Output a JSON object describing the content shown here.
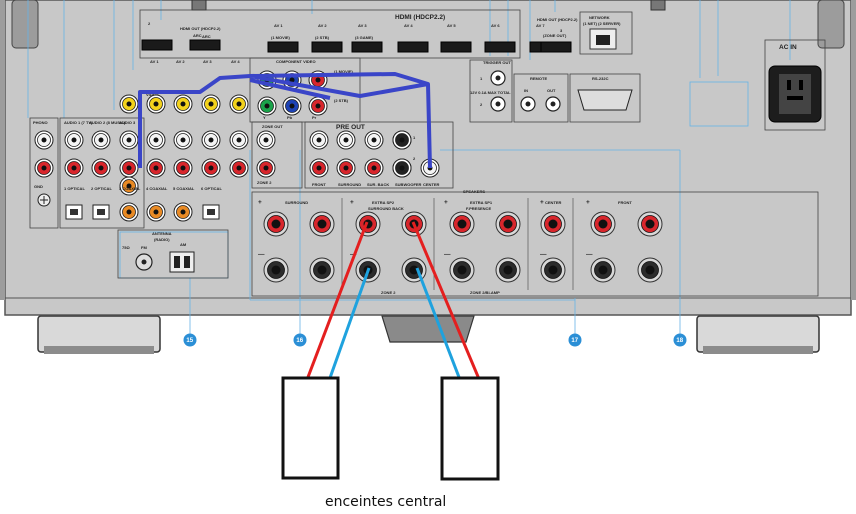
{
  "diagram": {
    "caption": "enceintes central",
    "callouts": [
      "15",
      "16",
      "17",
      "18"
    ],
    "colors": {
      "panel": "#c8c8c8",
      "panel_border": "#555555",
      "callout": "#2b8fd6",
      "hdmi_cable": "#3a45c8",
      "wire_red": "#e41f1f",
      "wire_blue": "#1fa2de",
      "rca_red": "#d8262c",
      "rca_yellow": "#f3d21c",
      "rca_white": "#f4f4f4",
      "rca_green": "#1aa34a",
      "rca_blue": "#1e43b5",
      "rca_orange": "#e98a24"
    },
    "hdmi": {
      "section_label": "HDMI (HDCP2.2)",
      "out_label": "HDMI OUT (HDCP2.2)",
      "out_sub": "ARC",
      "out2_label": "HDMI OUT (HDCP2.2)",
      "out2_sub": "(ZONE OUT)",
      "ports": [
        {
          "top": "2",
          "bottom": ""
        },
        {
          "top": "",
          "bottom": "ARC"
        },
        {
          "top": "1",
          "bottom": ""
        },
        {
          "top": "AV 1",
          "bottom": "(1 MOVIE)"
        },
        {
          "top": "AV 2",
          "bottom": "(2 STB)"
        },
        {
          "top": "AV 3",
          "bottom": "(3 GAME)"
        },
        {
          "top": "AV 4",
          "bottom": ""
        },
        {
          "top": "AV 5",
          "bottom": ""
        },
        {
          "top": "AV 6",
          "bottom": ""
        },
        {
          "top": "AV 7",
          "bottom": ""
        },
        {
          "top": "3",
          "bottom": "(ZONE OUT)"
        }
      ]
    },
    "network": {
      "label": "NETWORK",
      "sub": "(1 NET) (2 SERVER)"
    },
    "ac_in": "AC IN",
    "av_row": [
      "AV 1",
      "AV 2",
      "AV 3",
      "AV 4"
    ],
    "component": {
      "label": "COMPONENT VIDEO",
      "y": "Y",
      "pb": "Pb",
      "pr": "Pr",
      "sub1": "(1 MOVIE)",
      "sub2": "(2 STB)"
    },
    "trigger": {
      "label": "TRIGGER OUT",
      "j1": "1",
      "j2": "2",
      "sub": "12V 0.1A MAX TOTAL"
    },
    "remote": {
      "label": "REMOTE",
      "in": "IN",
      "out": "OUT"
    },
    "rs232c": "RS-232C",
    "phono": {
      "label": "PHONO",
      "gnd": "GND"
    },
    "audio": [
      "AUDIO 1 (7 TV)",
      "AUDIO 2 (8 MUSIC)",
      "AUDIO 3"
    ],
    "video": "VIDEO",
    "digital": [
      "1 OPTICAL",
      "2 OPTICAL",
      "3 COAXIAL",
      "4 COAXIAL",
      "5 COAXIAL",
      "6 OPTICAL"
    ],
    "antenna": {
      "label": "ANTENNA",
      "sub": "(RADIO)",
      "fm": "FM",
      "fm_ohm": "75Ω",
      "am": "AM"
    },
    "zone_out": {
      "label": "ZONE OUT",
      "sub": "ZONE 2"
    },
    "pre_out": {
      "label": "PRE OUT",
      "channels": [
        "FRONT",
        "SURROUND",
        "SUR. BACK",
        "SUBWOOFER",
        "CENTER"
      ],
      "sw1": "1",
      "sw2": "2"
    },
    "speakers": {
      "label": "SPEAKERS",
      "groups": [
        {
          "title": "SURROUND",
          "sub": ""
        },
        {
          "title": "EXTRA SP2",
          "sub": "SURROUND BACK"
        },
        {
          "title": "EXTRA SP1",
          "sub": "F.PRESENCE"
        },
        {
          "title": "CENTER",
          "sub": ""
        },
        {
          "title": "FRONT",
          "sub": ""
        }
      ],
      "zone2": "ZONE 2",
      "zone2bi": "ZONE 2/BI-AMP",
      "plus": "+",
      "minus": "—",
      "r": "R",
      "l": "L"
    }
  }
}
